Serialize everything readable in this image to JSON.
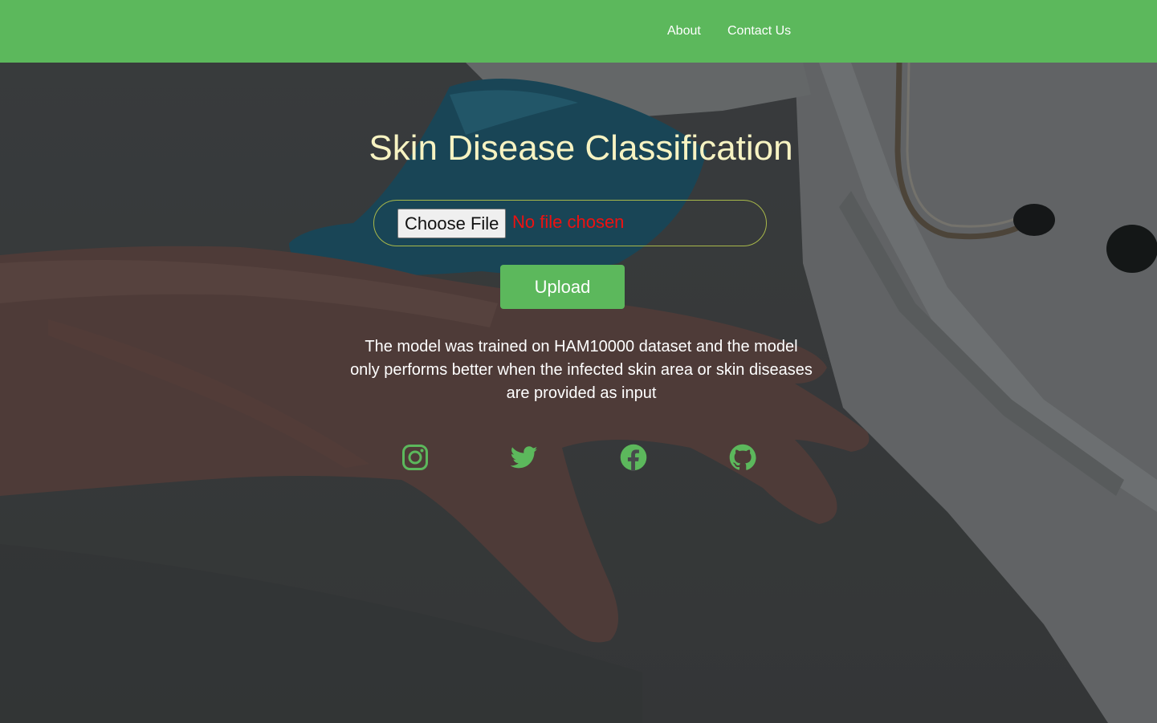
{
  "nav": {
    "links": [
      "About",
      "Contact Us"
    ]
  },
  "main": {
    "title": "Skin Disease Classification",
    "file_input": {
      "button_label": "Choose File",
      "status_text": "No file chosen"
    },
    "upload_label": "Upload",
    "description": "The model was trained on HAM10000 dataset and the model only performs better when the infected skin area or skin diseases are provided as input"
  },
  "social": {
    "icons": [
      "instagram-icon",
      "twitter-icon",
      "facebook-icon",
      "github-icon"
    ]
  },
  "colors": {
    "accent": "#5cb85c",
    "title": "#f7f3c2",
    "status_error": "#ee1111"
  }
}
